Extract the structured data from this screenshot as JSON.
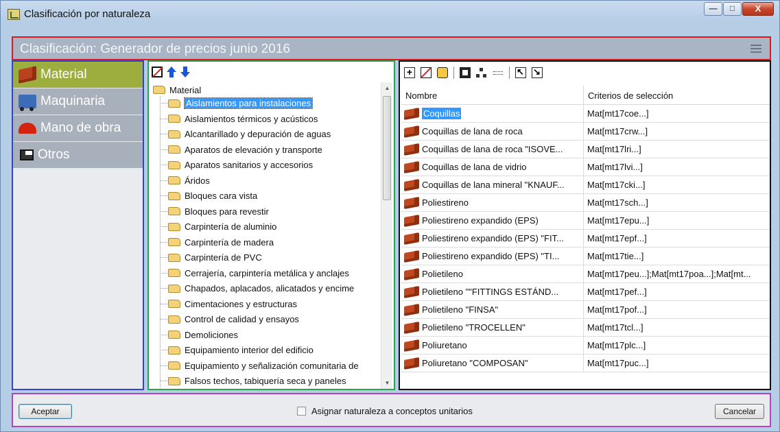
{
  "window": {
    "title": "Clasificación por naturaleza",
    "minimize_glyph": "—",
    "maximize_glyph": "□",
    "close_glyph": "X"
  },
  "header": {
    "title": "Clasificación: Generador de precios junio 2016"
  },
  "natures": [
    {
      "label": "Material",
      "icon": "brick-icon",
      "active": true
    },
    {
      "label": "Maquinaria",
      "icon": "truck-icon",
      "active": false
    },
    {
      "label": "Mano de obra",
      "icon": "helmet-icon",
      "active": false
    },
    {
      "label": "Otros",
      "icon": "other-icon",
      "active": false
    }
  ],
  "tree": {
    "root": "Material",
    "items": [
      "Aislamientos para instalaciones",
      "Aislamientos térmicos y acústicos",
      "Alcantarillado y depuración de aguas",
      "Aparatos de elevación y transporte",
      "Aparatos sanitarios y accesorios",
      "Áridos",
      "Bloques cara vista",
      "Bloques para revestir",
      "Carpintería de aluminio",
      "Carpintería de madera",
      "Carpintería de PVC",
      "Cerrajería, carpintería metálica y anclajes",
      "Chapados, aplacados, alicatados y encime",
      "Cimentaciones y estructuras",
      "Control de calidad y ensayos",
      "Demoliciones",
      "Equipamiento interior del edificio",
      "Equipamiento y señalización comunitaria de",
      "Falsos techos, tabiquería seca y paneles"
    ],
    "selected_index": 0
  },
  "list": {
    "columns": [
      "Nombre",
      "Criterios de selección"
    ],
    "rows": [
      {
        "name": "Coquillas",
        "criteria": "Mat[mt17coe...]"
      },
      {
        "name": "Coquillas de lana de roca",
        "criteria": "Mat[mt17crw...]"
      },
      {
        "name": "Coquillas de lana de roca \"ISOVE...",
        "criteria": "Mat[mt17lri...]"
      },
      {
        "name": "Coquillas de lana de vidrio",
        "criteria": "Mat[mt17lvi...]"
      },
      {
        "name": "Coquillas de lana mineral \"KNAUF...",
        "criteria": "Mat[mt17cki...]"
      },
      {
        "name": "Poliestireno",
        "criteria": "Mat[mt17sch...]"
      },
      {
        "name": "Poliestireno expandido (EPS)",
        "criteria": "Mat[mt17epu...]"
      },
      {
        "name": "Poliestireno expandido (EPS) \"FIT...",
        "criteria": "Mat[mt17epf...]"
      },
      {
        "name": "Poliestireno expandido (EPS) \"TI...",
        "criteria": "Mat[mt17tie...]"
      },
      {
        "name": "Polietileno",
        "criteria": "Mat[mt17peu...];Mat[mt17poa...];Mat[mt..."
      },
      {
        "name": "Polietileno \"\"FITTINGS ESTÁND...",
        "criteria": "Mat[mt17pef...]"
      },
      {
        "name": "Polietileno \"FINSA\"",
        "criteria": "Mat[mt17pof...]"
      },
      {
        "name": "Polietileno \"TROCELLEN\"",
        "criteria": "Mat[mt17tcl...]"
      },
      {
        "name": "Poliuretano",
        "criteria": "Mat[mt17plc...]"
      },
      {
        "name": "Poliuretano \"COMPOSAN\"",
        "criteria": "Mat[mt17puc...]"
      }
    ],
    "selected_index": 0
  },
  "footer": {
    "accept_label": "Aceptar",
    "checkbox_label": "Asignar naturaleza a conceptos unitarios",
    "checkbox_checked": false,
    "cancel_label": "Cancelar"
  }
}
